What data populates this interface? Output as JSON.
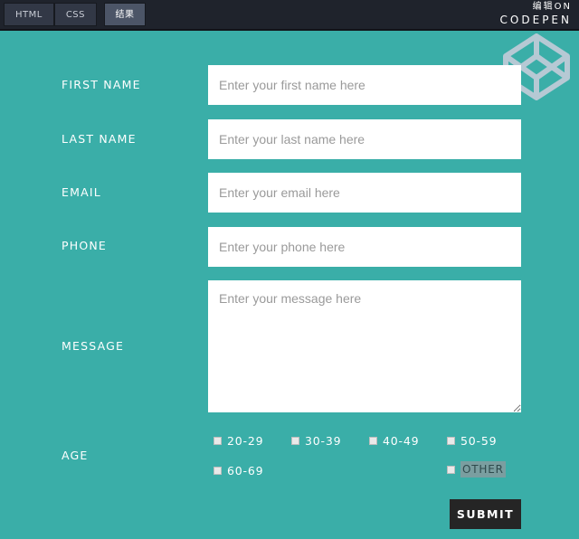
{
  "tabs": [
    {
      "label": "HTML"
    },
    {
      "label": "CSS"
    },
    {
      "label": "结果"
    }
  ],
  "brand": {
    "edit_on": "编辑ON",
    "name": "CODEPEN"
  },
  "form": {
    "first_name": {
      "label": "FIRST NAME",
      "placeholder": "Enter your first name here"
    },
    "last_name": {
      "label": "LAST NAME",
      "placeholder": "Enter your last name here"
    },
    "email": {
      "label": "EMAIL",
      "placeholder": "Enter your email here"
    },
    "phone": {
      "label": "PHONE",
      "placeholder": "Enter your phone here"
    },
    "message": {
      "label": "MESSAGE",
      "placeholder": "Enter your message here"
    },
    "age": {
      "label": "AGE",
      "options": [
        "20-29",
        "30-39",
        "40-49",
        "50-59",
        "60-69",
        "OTHER"
      ]
    },
    "submit_label": "SUBMIT"
  },
  "colors": {
    "background": "#3aaea8",
    "topbar": "#1f232c",
    "submit": "#252525"
  }
}
